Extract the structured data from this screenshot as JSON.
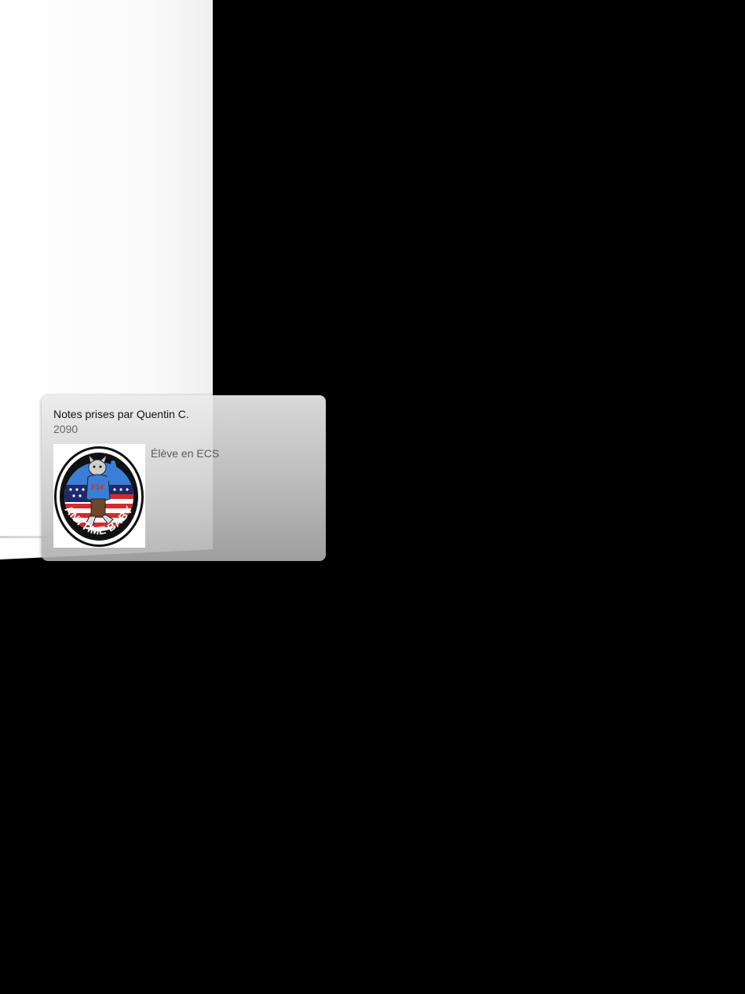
{
  "card": {
    "title": "Notes prises par Quentin C.",
    "subtitle": "2090",
    "description": "Élève en ECS",
    "thumbnail": {
      "icon": "anytime-baby-patch",
      "text": "ANYTIME BABY",
      "badge_text": "F14"
    }
  },
  "colors": {
    "background": "#000000",
    "sheet": "#ffffff",
    "patch_blue": "#3a7fd5",
    "patch_red": "#d62a2a",
    "patch_navy": "#1d2a6b"
  }
}
